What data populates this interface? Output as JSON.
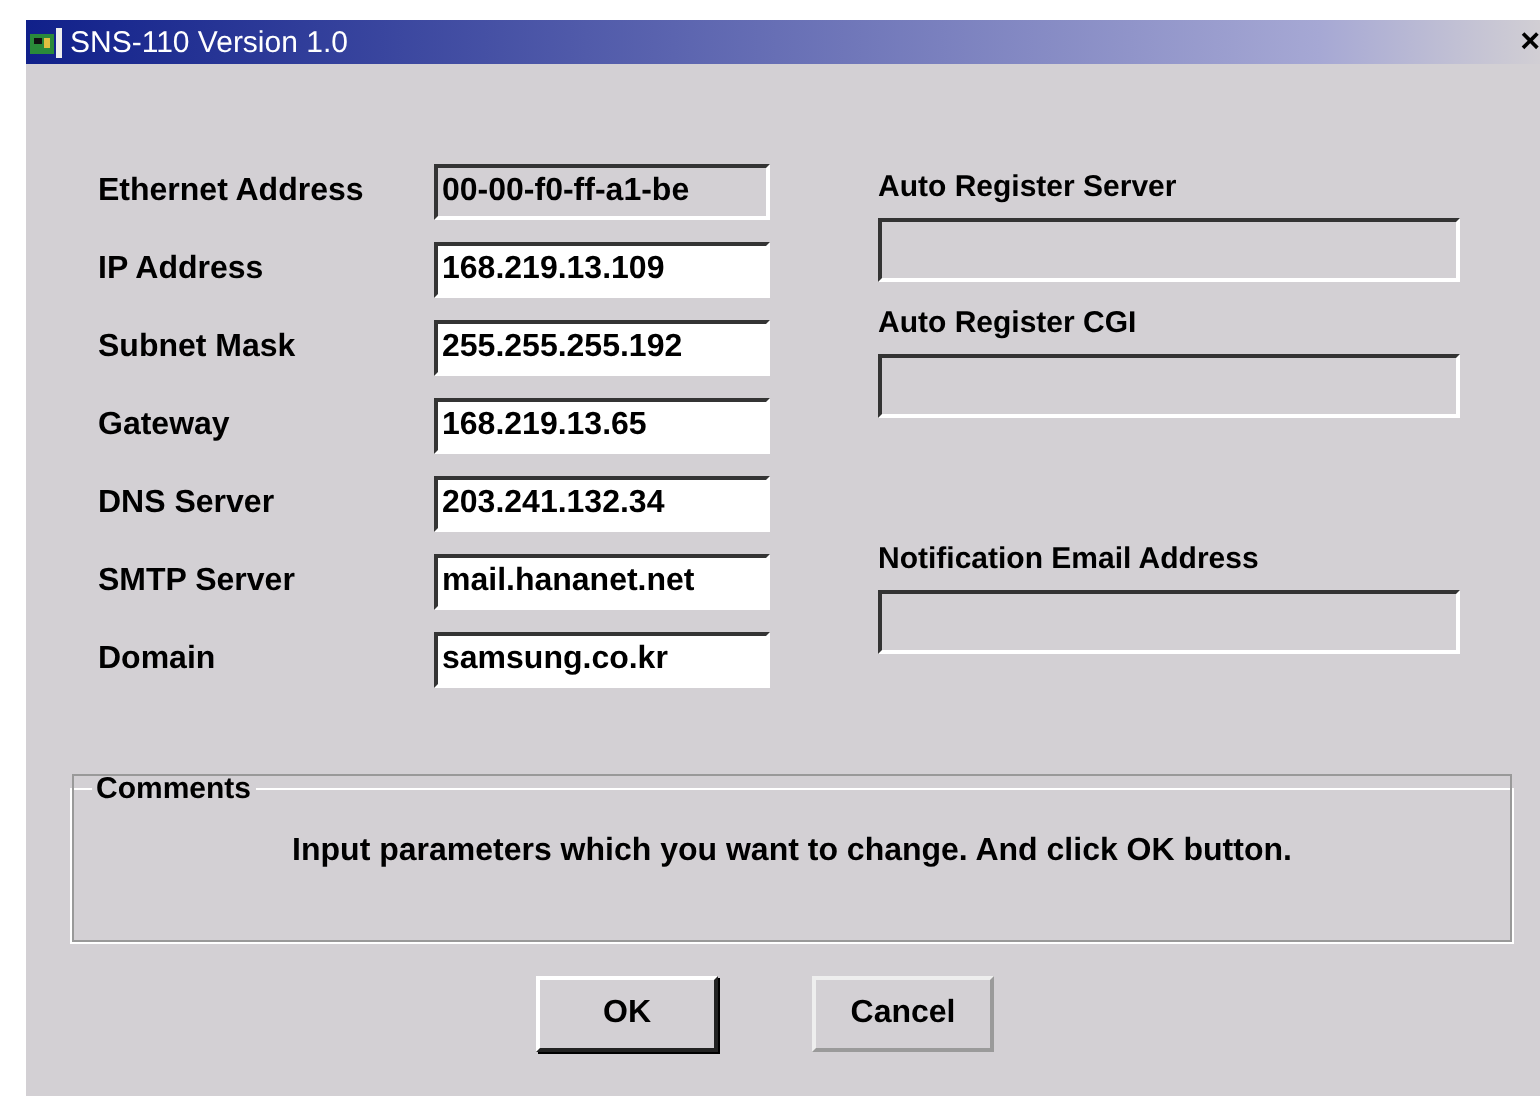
{
  "window": {
    "title": "SNS-110 Version 1.0",
    "close": "×"
  },
  "network_fields": [
    {
      "label": "Ethernet Address",
      "value": "00-00-f0-ff-a1-be",
      "disabled": true
    },
    {
      "label": "IP Address",
      "value": "168.219.13.109",
      "disabled": false
    },
    {
      "label": "Subnet Mask",
      "value": "255.255.255.192",
      "disabled": false
    },
    {
      "label": "Gateway",
      "value": "168.219.13.65",
      "disabled": false
    },
    {
      "label": "DNS Server",
      "value": "203.241.132.34",
      "disabled": false
    },
    {
      "label": "SMTP Server",
      "value": "mail.hananet.net",
      "disabled": false
    },
    {
      "label": "Domain",
      "value": "samsung.co.kr",
      "disabled": false
    }
  ],
  "register_fields": [
    {
      "label": "Auto Register Server",
      "disabled": true
    },
    {
      "label": "Auto Register CGI",
      "disabled": true
    },
    {
      "label": "Notification Email Address",
      "disabled": true
    }
  ],
  "comments": {
    "title": "Comments",
    "text": "Input parameters which you want to change. And click OK button."
  },
  "buttons": [
    {
      "label": "OK",
      "default": true
    },
    {
      "label": "Cancel",
      "default": false
    }
  ]
}
